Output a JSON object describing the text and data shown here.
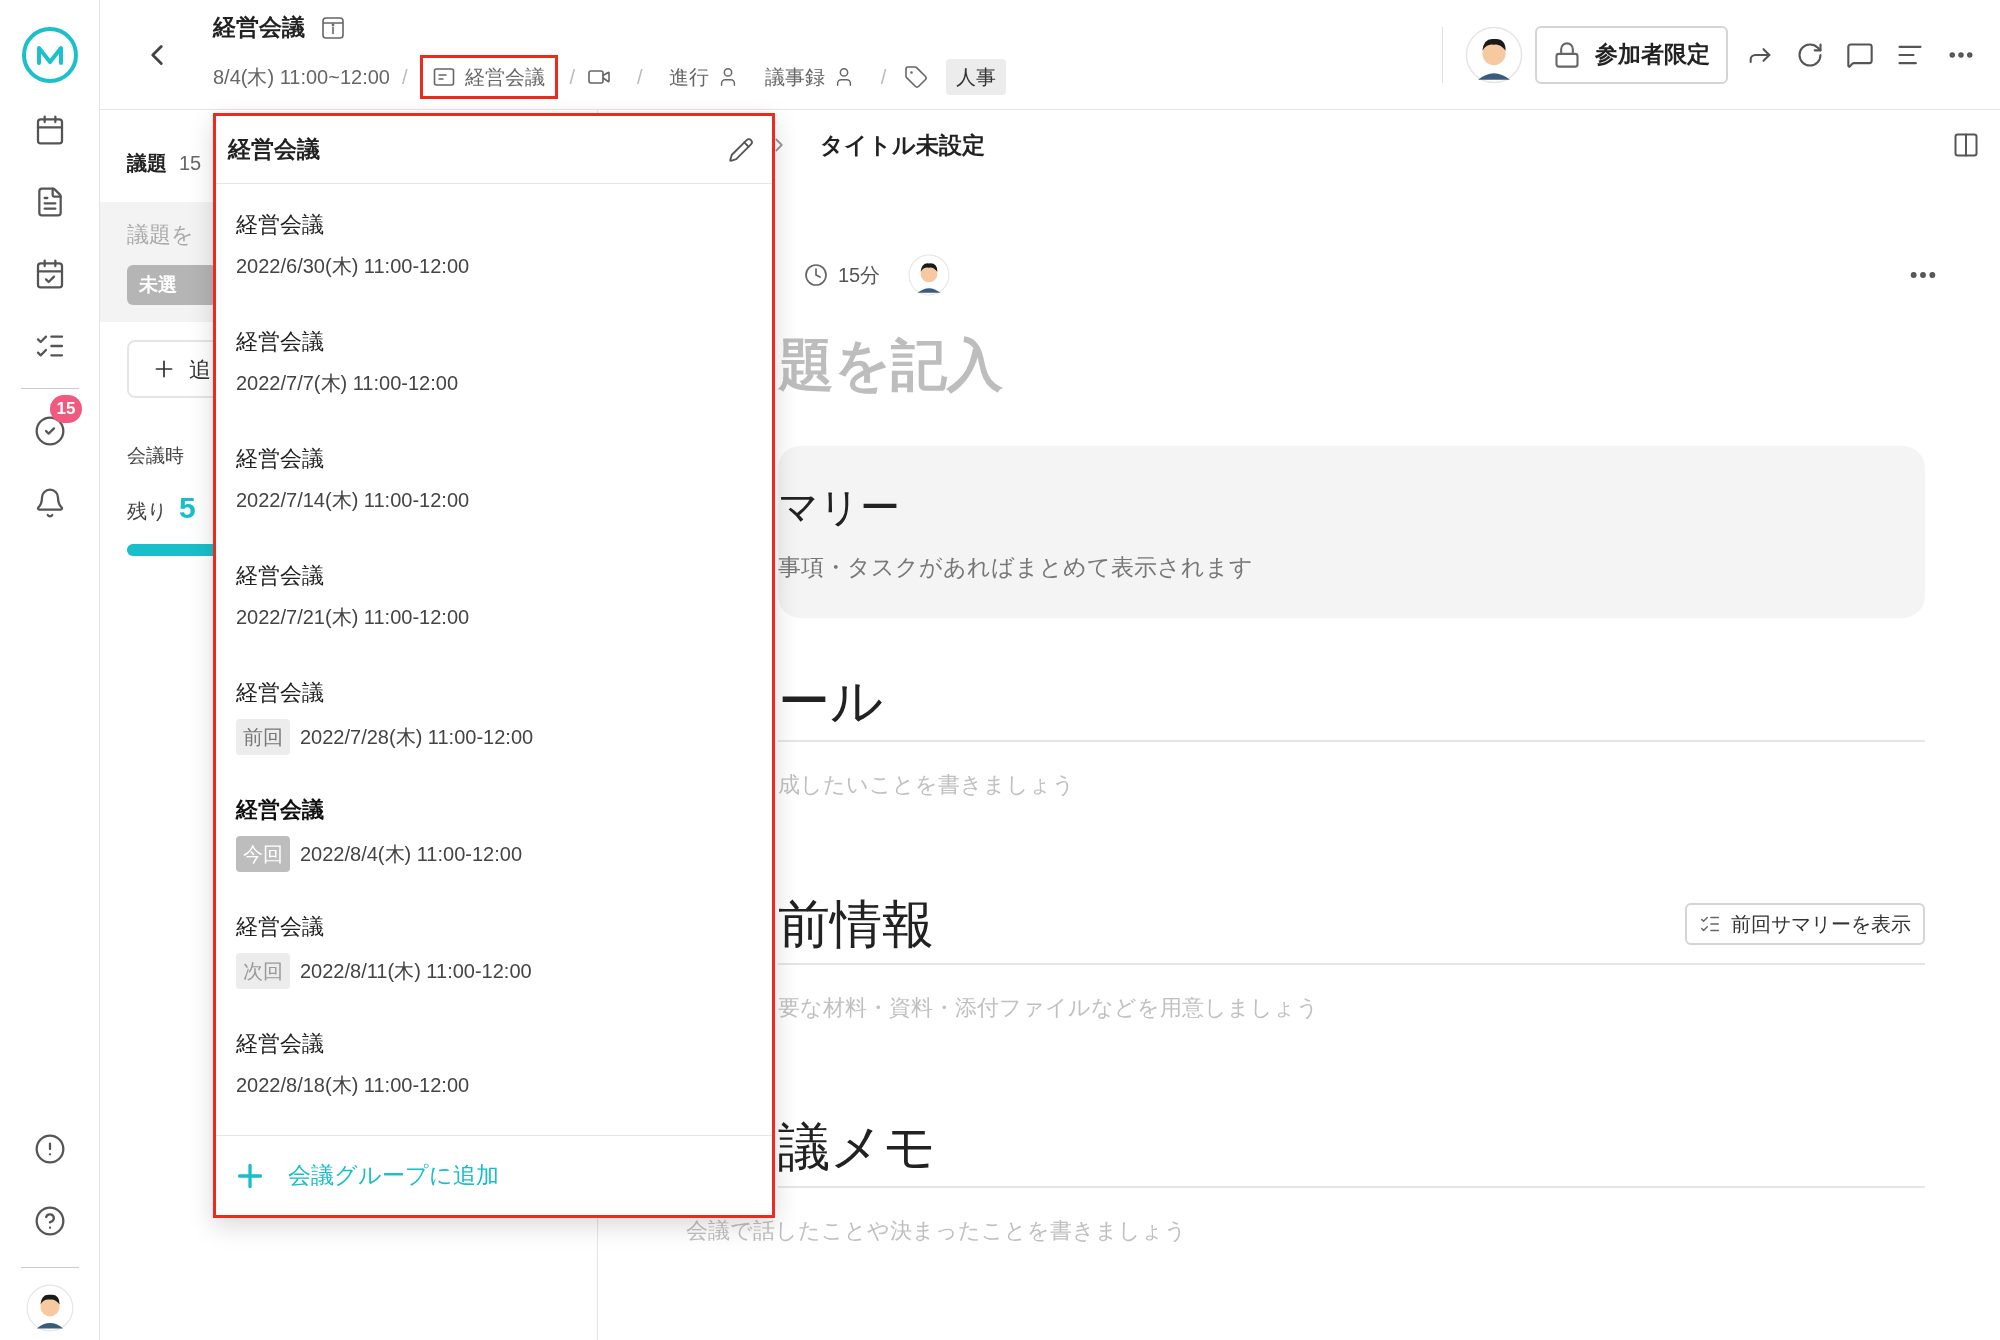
{
  "app_sidebar": {
    "notification_count": "15"
  },
  "header": {
    "separators": [
      "/",
      "/",
      "/",
      "/"
    ],
    "title": "経営会議",
    "datetime": "8/4(木) 11:00~12:00",
    "group_chip": {
      "label": "経営会議",
      "highlighted": true
    },
    "roles": [
      {
        "label": "進行"
      },
      {
        "label": "議事録"
      }
    ],
    "tag": "人事",
    "access_button": "参加者限定"
  },
  "agenda_panel": {
    "label": "議題",
    "count": "15",
    "item_title": "議題を",
    "status_badge": "未選",
    "add_button": "追",
    "time_label": "会議時",
    "remaining_label": "残り",
    "remaining_value": "5",
    "level": 0.9
  },
  "main": {
    "breadcrumb": "タイトル未設定",
    "duration": "15分",
    "title_hint": "題を記入",
    "summary": {
      "heading": "マリー",
      "text": "事項・タスクがあればまとめて表示されます"
    },
    "sections": [
      {
        "heading": "ール",
        "hint": "成したいことを書きましょう"
      },
      {
        "heading": "前情報",
        "hint": "要な材料・資料・添付ファイルなどを用意しましょう",
        "button": "前回サマリーを表示"
      },
      {
        "heading": "議メモ",
        "hint": "会議で話したことや決まったことを書きましょう"
      }
    ]
  },
  "dropdown": {
    "title": "経営会議",
    "highlighted": true,
    "items": [
      {
        "title": "経営会議",
        "date": "2022/6/30(木) 11:00-12:00",
        "selected": false
      },
      {
        "title": "経営会議",
        "date": "2022/7/7(木) 11:00-12:00",
        "selected": false
      },
      {
        "title": "経営会議",
        "date": "2022/7/14(木) 11:00-12:00",
        "selected": false
      },
      {
        "title": "経営会議",
        "date": "2022/7/21(木) 11:00-12:00",
        "selected": false
      },
      {
        "title": "経営会議",
        "date": "2022/7/28(木) 11:00-12:00",
        "selected": false,
        "badge": {
          "text": "前回",
          "kind": "previous"
        }
      },
      {
        "title": "経営会議",
        "date": "2022/8/4(木) 11:00-12:00",
        "selected": true,
        "badge": {
          "text": "今回",
          "kind": "current"
        }
      },
      {
        "title": "経営会議",
        "date": "2022/8/11(木) 11:00-12:00",
        "selected": false,
        "badge": {
          "text": "次回",
          "kind": "next"
        }
      },
      {
        "title": "経営会議",
        "date": "2022/8/18(木) 11:00-12:00",
        "selected": false
      }
    ],
    "add_label": "会議グループに追加"
  }
}
